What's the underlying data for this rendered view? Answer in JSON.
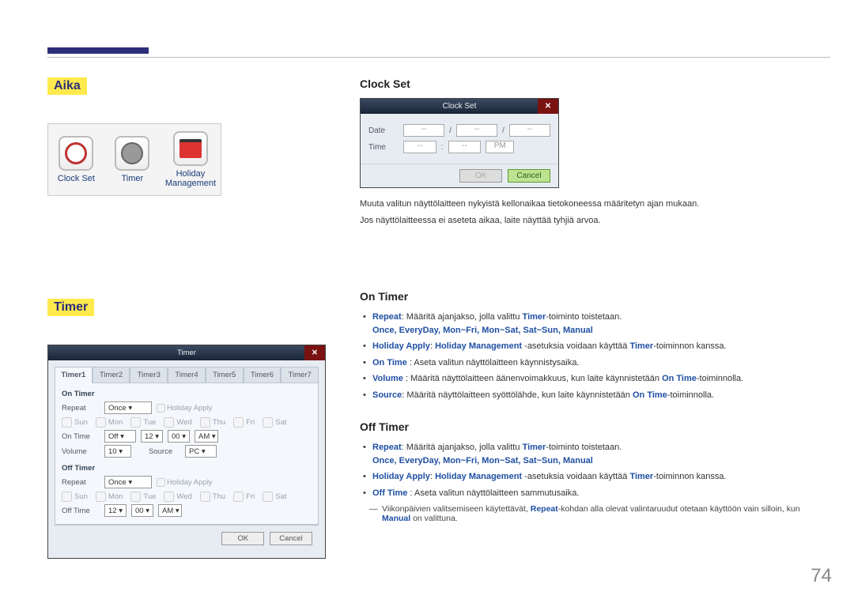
{
  "page_number": "74",
  "left": {
    "heading_aika": "Aika",
    "icons": {
      "clock_set": "Clock Set",
      "timer": "Timer",
      "holiday": "Holiday Management"
    },
    "heading_timer": "Timer",
    "timer_dialog": {
      "title": "Timer",
      "tabs": [
        "Timer1",
        "Timer2",
        "Timer3",
        "Timer4",
        "Timer5",
        "Timer6",
        "Timer7"
      ],
      "on_timer_h": "On Timer",
      "off_timer_h": "Off Timer",
      "repeat_lbl": "Repeat",
      "repeat_val": "Once",
      "holiday_apply": "Holiday Apply",
      "days": [
        "Sun",
        "Mon",
        "Tue",
        "Wed",
        "Thu",
        "Fri",
        "Sat"
      ],
      "on_time_lbl": "On Time",
      "on_time_state": "Off",
      "on_h": "12",
      "on_m": "00",
      "on_ampm": "AM",
      "off_time_lbl": "Off Time",
      "off_h": "12",
      "off_m": "00",
      "off_ampm": "AM",
      "volume_lbl": "Volume",
      "volume_val": "10",
      "source_lbl": "Source",
      "source_val": "PC",
      "ok": "OK",
      "cancel": "Cancel"
    }
  },
  "right": {
    "clockset_h": "Clock Set",
    "clockset_dialog": {
      "title": "Clock Set",
      "date": "Date",
      "time": "Time",
      "pm": "PM",
      "ok": "OK",
      "cancel": "Cancel",
      "sep": "/",
      "placeholder": "--"
    },
    "clockset_p1": "Muuta valitun näyttölaitteen nykyistä kellonaikaa tietokoneessa määritetyn ajan mukaan.",
    "clockset_p2": "Jos näyttölaitteessa ei aseteta aikaa, laite näyttää tyhjiä arvoa.",
    "ontimer_h": "On Timer",
    "offtimer_h": "Off Timer",
    "bullets": {
      "repeat_pre": "Repeat",
      "repeat_txt": ": Määritä ajanjakso, jolla valittu ",
      "repeat_tok": "Timer",
      "repeat_tail": "-toiminto toistetaan.",
      "repeat_opts": "Once, EveryDay, Mon~Fri, Mon~Sat, Sat~Sun, Manual",
      "ha_pre": "Holiday Apply",
      "ha_mid": ": ",
      "ha_tok": "Holiday Management",
      "ha_txt": " -asetuksia voidaan käyttää ",
      "ha_tok2": "Timer",
      "ha_tail": "-toiminnon kanssa.",
      "ontime_pre": "On Time",
      "ontime_txt": "  :  Aseta valitun näyttölaitteen käynnistysaika.",
      "vol_pre": "Volume",
      "vol_txt": "  :  Määritä näyttölaitteen äänenvoimakkuus, kun laite käynnistetään ",
      "vol_tok": "On Time",
      "vol_tail": "-toiminnolla.",
      "src_pre": "Source",
      "src_txt": ": Määritä näyttölaitteen syöttölähde, kun laite käynnistetään ",
      "src_tok": "On Time",
      "src_tail": "-toiminnolla.",
      "offtime_pre": "Off Time",
      "offtime_txt": "  :  Aseta valitun näyttölaitteen sammutusaika.",
      "note_a": "Viikonpäivien valitsemiseen käytettävät, ",
      "note_tok": "Repeat",
      "note_b": "-kohdan alla olevat valintaruudut otetaan käyttöön vain silloin, kun ",
      "note_tok2": "Manual",
      "note_c": " on valittuna."
    }
  }
}
